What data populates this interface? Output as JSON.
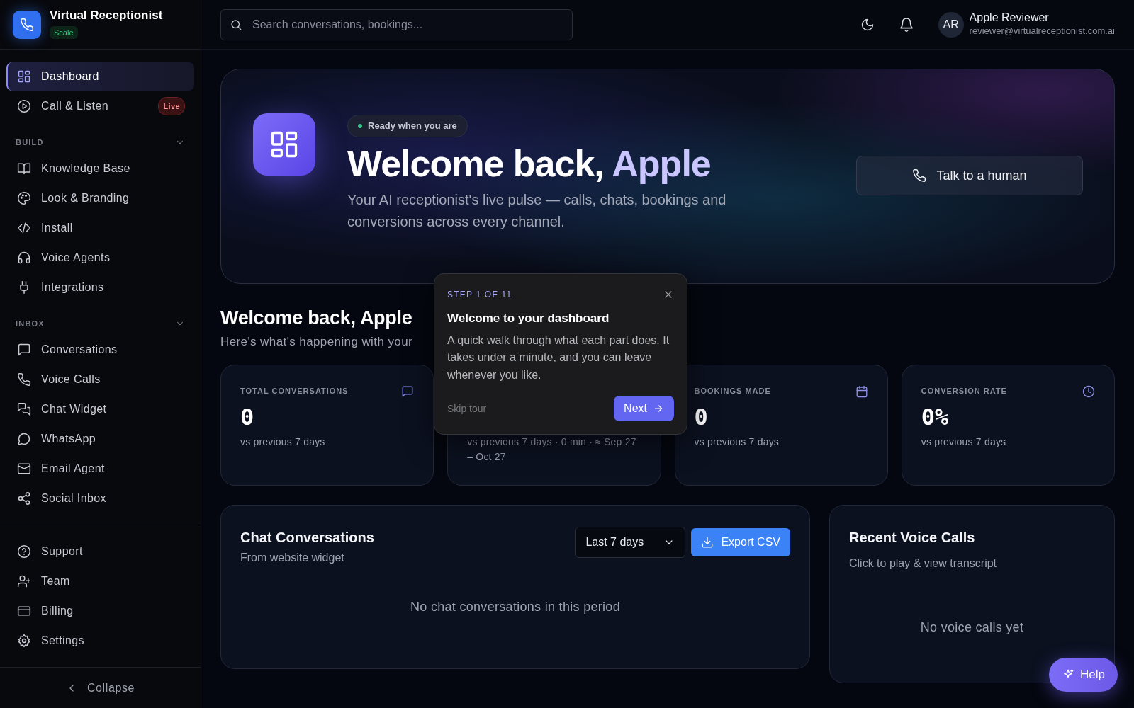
{
  "sidebar": {
    "brand": {
      "name": "Virtual Receptionist",
      "plan": "Scale"
    },
    "items": [
      {
        "label": "Dashboard",
        "selected": true
      },
      {
        "label": "Call & Listen",
        "selected": false,
        "badge": "Live"
      }
    ],
    "sections": [
      {
        "title": "BUILD",
        "expanded": true,
        "items": [
          {
            "label": "Knowledge Base",
            "selected": false
          },
          {
            "label": "Look & Branding",
            "selected": false
          },
          {
            "label": "Install",
            "selected": false
          },
          {
            "label": "Voice Agents",
            "selected": false
          },
          {
            "label": "Integrations",
            "selected": false
          }
        ]
      },
      {
        "title": "INBOX",
        "expanded": true,
        "items": [
          {
            "label": "Conversations",
            "selected": false
          },
          {
            "label": "Voice Calls",
            "selected": false
          },
          {
            "label": "Chat Widget",
            "selected": false
          },
          {
            "label": "WhatsApp",
            "selected": false
          },
          {
            "label": "Email Agent",
            "selected": false
          },
          {
            "label": "Social Inbox",
            "selected": false
          }
        ]
      }
    ],
    "footer_items": [
      {
        "label": "Support",
        "selected": false
      },
      {
        "label": "Team",
        "selected": false
      },
      {
        "label": "Billing",
        "selected": false
      },
      {
        "label": "Settings",
        "selected": false
      }
    ],
    "collapse": "Collapse"
  },
  "topbar": {
    "search": {
      "placeholder": "Search conversations, bookings..."
    },
    "user": {
      "initials": "AR",
      "name": "Apple Reviewer",
      "email": "reviewer@virtualreceptionist.com.ai"
    }
  },
  "hero": {
    "badge": "Ready when you are",
    "title_prefix": "Welcome back,",
    "title_name": "Apple",
    "description": "Your AI receptionist's live pulse — calls, chats, bookings and conversions across every channel.",
    "button": "Talk to a human"
  },
  "welcome": {
    "title": "Welcome back, Apple",
    "subtitle": "Here's what's happening with your"
  },
  "stats": [
    {
      "label": "TOTAL CONVERSATIONS",
      "value": "0",
      "note": "vs previous 7 days"
    },
    {
      "note": "vs previous 7 days · 0 min · ≈ Sep 27 – Oct 27"
    },
    {
      "label": "BOOKINGS MADE",
      "value": "0",
      "note": "vs previous 7 days"
    },
    {
      "label": "CONVERSION RATE",
      "value": "0%",
      "note": "vs previous 7 days"
    }
  ],
  "chat_card": {
    "title": "Chat Conversations",
    "subtitle": "From website widget",
    "range": "Last 7 days",
    "export": "Export CSV",
    "empty": "No chat conversations in this period"
  },
  "voice_card": {
    "title": "Recent Voice Calls",
    "subtitle": "Click to play & view transcript",
    "empty": "No voice calls yet"
  },
  "tour": {
    "step": "STEP 1 OF 11",
    "title": "Welcome to your dashboard",
    "body": "A quick walk through what each part does. It takes under a minute, and you can leave whenever you like.",
    "skip": "Skip tour",
    "next": "Next"
  },
  "help": "Help"
}
